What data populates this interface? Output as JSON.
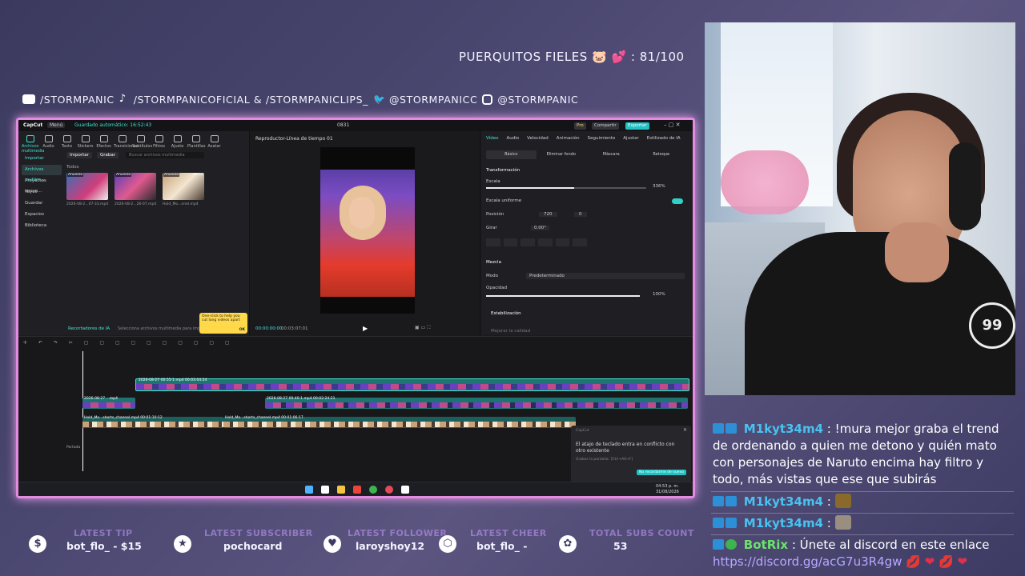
{
  "overlay": {
    "goal_text": "PUERQUITOS FIELES 🐷 💕 : 81/100",
    "socials": [
      {
        "icon": "youtube-icon",
        "label": "/STORMPANIC"
      },
      {
        "icon": "tiktok-icon",
        "label": "/STORMPANICOFICIAL & /STORMPANICLIPS_"
      },
      {
        "icon": "twitter-icon",
        "label": "@STORMPANICC"
      },
      {
        "icon": "instagram-icon",
        "label": "@STORMPANIC"
      }
    ]
  },
  "editor": {
    "app_name": "CapCut",
    "menu_label": "Menú",
    "autosave": "Guardado automático: 16:52:43",
    "project_name": "0831",
    "pro_label": "Pro",
    "share_label": "Compartir",
    "export_label": "Exportar",
    "tools": [
      "Archivos multimedia",
      "Audio",
      "Texto",
      "Stickers",
      "Efectos",
      "Transiciones",
      "Subtítulos",
      "Filtros",
      "Ajuste",
      "Plantillas",
      "Avatar"
    ],
    "import_button": "Importar",
    "record_button": "Grabar",
    "search_placeholder": "Buscar archivos multimedia",
    "side_menu": [
      "Importar",
      "Archivos multim...",
      "Proyectos secun...",
      "Tuyos",
      "Guardar",
      "Espacios",
      "Biblioteca"
    ],
    "all_label": "Todos",
    "media": [
      {
        "tag": "Añadido",
        "duration": "00:30",
        "name": "2026-08-2...07-33.mp4"
      },
      {
        "tag": "Añadido",
        "duration": "00:11",
        "name": "2026-08-2...26-07.mp4"
      },
      {
        "tag": "Añadido",
        "duration": "00:12",
        "name": "Hold_Mo...nnel.mp4"
      }
    ],
    "ai_recorder": "Recortadores de IA",
    "ai_hint": "Selecciona archivos multimedia para impo...",
    "player_title": "Reproductor-Línea de tiempo 01",
    "time_current": "00:00:00:00",
    "time_total": "00:03:07:01",
    "tooltip_text": "One-click to help you cut long videos apart",
    "tooltip_ok": "OK",
    "prop_tabs": [
      "Vídeo",
      "Audio",
      "Velocidad",
      "Animación",
      "Seguimiento",
      "Ajustar",
      "Estilizado de IA"
    ],
    "prop_subtabs": [
      "Básico",
      "Eliminar fondo",
      "Máscara",
      "Retoque"
    ],
    "transform_label": "Transformación",
    "scale_label": "Escala",
    "scale_value": "336%",
    "scale_fraction": 0.55,
    "uniform_scale": "Escala uniforme",
    "position_label": "Posición",
    "pos_x": "720",
    "pos_y": "0",
    "rotate_label": "Girar",
    "rotate_value": "0.00°",
    "blend_label": "Mezcla",
    "mode_label": "Modo",
    "mode_value": "Predeterminado",
    "opacity_label": "Opacidad",
    "opacity_value": "100%",
    "opacity_fraction": 1.0,
    "stabilize_label": "Estabilización",
    "stabilize_sub": "Mejorar la calidad",
    "track_labels": [
      "2026-08-27 00:55-1.mp4  00:03:04:24",
      "2026-08-27 ...mp4",
      "2026-08-27 00:40-1.mp4  00:02:24:21",
      "Hold_Mo...shorts_channel.mp4  00:01:10:12",
      "Hold_Mo...shorts_channel.mp4  00:01:06:17"
    ],
    "cover_label": "Portada",
    "toast_app": "CapCut",
    "toast_text": "El atajo de teclado entra en conflicto con otro existente",
    "toast_sub": "Grabar la pantalla: [Ctrl+Alt+F]",
    "toast_button": "No recordarme de nuevo",
    "clock_time": "04:53 p. m.",
    "clock_date": "31/08/2026"
  },
  "chat": {
    "messages": [
      {
        "user": "M1kyt34m4",
        "text": "!mura mejor graba el trend de ordenando a quien me detono y quién mato con personajes de Naruto encima hay filtro y todo, más vistas que ese que subirás"
      },
      {
        "user": "M1kyt34m4",
        "text": ""
      },
      {
        "user": "M1kyt34m4",
        "text": ""
      },
      {
        "user": "BotRix",
        "text": "Únete al discord en este enlace",
        "link": "https://discord.gg/acG7u3R4gw",
        "hearts": "💋 ❤ 💋 ❤"
      }
    ]
  },
  "stats": [
    {
      "icon": "dollar-icon",
      "title": "LATEST TIP",
      "value": "bot_flo_ - $15"
    },
    {
      "icon": "star-icon",
      "title": "LATEST SUBSCRIBER",
      "value": "pochocard"
    },
    {
      "icon": "heart-icon",
      "title": "LATEST FOLLOWER",
      "value": "laroyshoy12"
    },
    {
      "icon": "cheer-icon",
      "title": "LATEST CHEER",
      "value": "bot_flo_ -"
    },
    {
      "icon": "paw-icon",
      "title": "TOTAL SUBS COUNT",
      "value": "53"
    }
  ],
  "colors": {
    "frame_border": "#e38be0",
    "accent_teal": "#49e3d5",
    "chat_name": "#49c2f0",
    "bot_name": "#6be36b"
  }
}
